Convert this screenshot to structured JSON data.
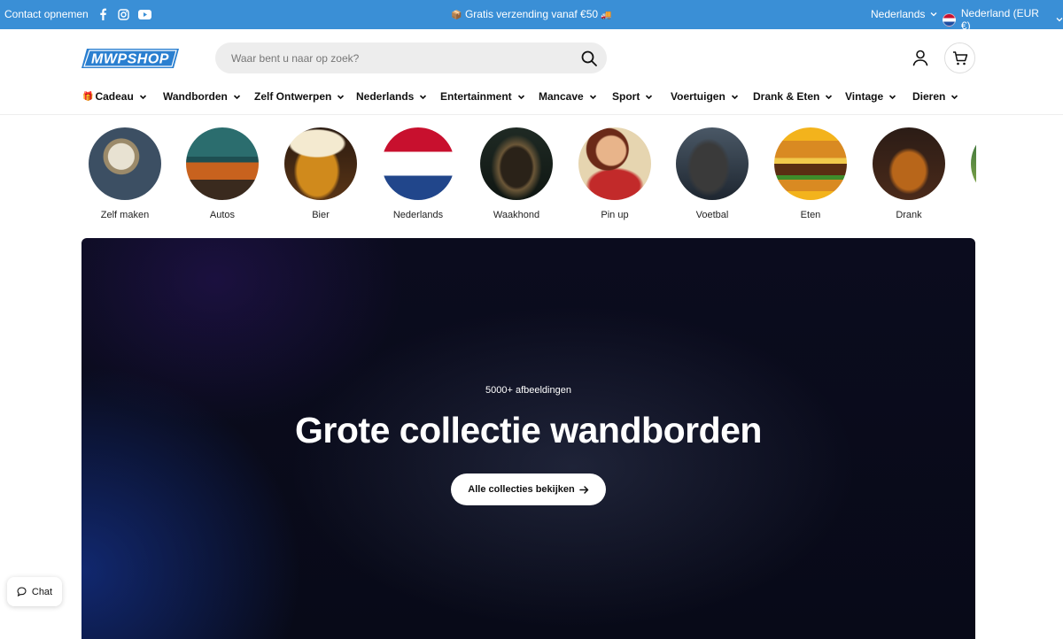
{
  "topbar": {
    "contact": "Contact opnemen",
    "social_icons": [
      "facebook-icon",
      "instagram-icon",
      "youtube-icon"
    ],
    "announcement": "Gratis verzending vanaf €50",
    "language": "Nederlands",
    "country": "Nederland (EUR €)",
    "bg_color": "#3a8fd6"
  },
  "header": {
    "logo_text": "MWPSHOP",
    "search_placeholder": "Waar bent u naar op zoek?"
  },
  "nav": {
    "items": [
      {
        "label": "Cadeau"
      },
      {
        "label": "Wandborden"
      },
      {
        "label": "Zelf Ontwerpen"
      },
      {
        "label": "Nederlands"
      },
      {
        "label": "Entertainment"
      },
      {
        "label": "Mancave"
      },
      {
        "label": "Sport"
      },
      {
        "label": "Voertuigen"
      },
      {
        "label": "Drank & Eten"
      },
      {
        "label": "Vintage"
      },
      {
        "label": "Dieren"
      }
    ]
  },
  "categories": [
    {
      "label": "Zelf maken"
    },
    {
      "label": "Autos"
    },
    {
      "label": "Bier"
    },
    {
      "label": "Nederlands"
    },
    {
      "label": "Waakhond"
    },
    {
      "label": "Pin up"
    },
    {
      "label": "Voetbal"
    },
    {
      "label": "Eten"
    },
    {
      "label": "Drank"
    }
  ],
  "hero": {
    "eyebrow": "5000+ afbeeldingen",
    "title": "Grote collectie wandborden",
    "cta": "Alle collecties bekijken"
  },
  "chat": {
    "label": "Chat"
  }
}
